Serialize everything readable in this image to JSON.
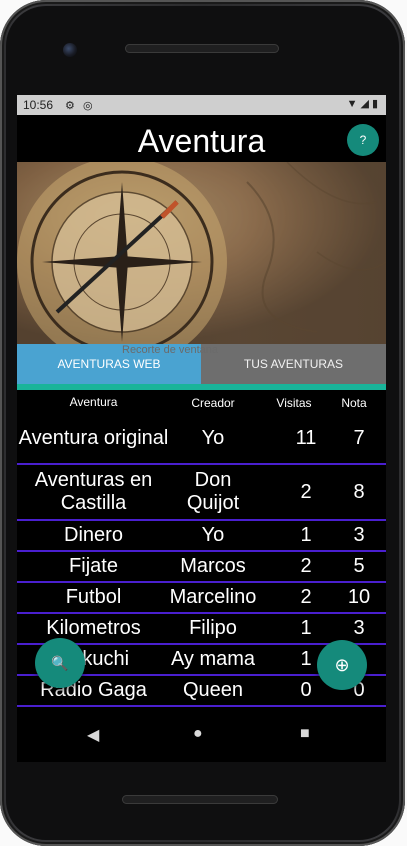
{
  "status": {
    "time": "10:56"
  },
  "app": {
    "title": "Aventura",
    "help_label": "?"
  },
  "tabs": {
    "web": "AVENTURAS WEB",
    "tus": "TUS AVENTURAS",
    "overlay": "Recorte de ventana"
  },
  "table": {
    "headers": [
      "Aventura",
      "Creador",
      "Visitas",
      "Nota"
    ],
    "rows": [
      {
        "aventura": "Aventura original",
        "creador": "Yo",
        "visitas": "11",
        "nota": "7"
      },
      {
        "aventura": "Aventuras en Castilla",
        "creador": "Don Quijot",
        "visitas": "2",
        "nota": "8"
      },
      {
        "aventura": "Dinero",
        "creador": "Yo",
        "visitas": "1",
        "nota": "3"
      },
      {
        "aventura": "Fijate",
        "creador": "Marcos",
        "visitas": "2",
        "nota": "5"
      },
      {
        "aventura": "Futbol",
        "creador": "Marcelino",
        "visitas": "2",
        "nota": "10"
      },
      {
        "aventura": "Kilometros",
        "creador": "Filipo",
        "visitas": "1",
        "nota": "3"
      },
      {
        "aventura": "Kukuchi",
        "creador": "Ay mama",
        "visitas": "1",
        "nota": "0"
      },
      {
        "aventura": "Radio Gaga",
        "creador": "Queen",
        "visitas": "0",
        "nota": "0"
      }
    ]
  },
  "fabs": {
    "search_icon": "🔍",
    "add_icon": "⊕"
  },
  "nav": {
    "back_icon": "◀",
    "home_icon": "●",
    "recents_icon": "■"
  },
  "colors": {
    "accent": "#158a7b",
    "tab_active": "#4aa3d1",
    "divider": "#4a1fcf",
    "indicator": "#19b49a"
  }
}
